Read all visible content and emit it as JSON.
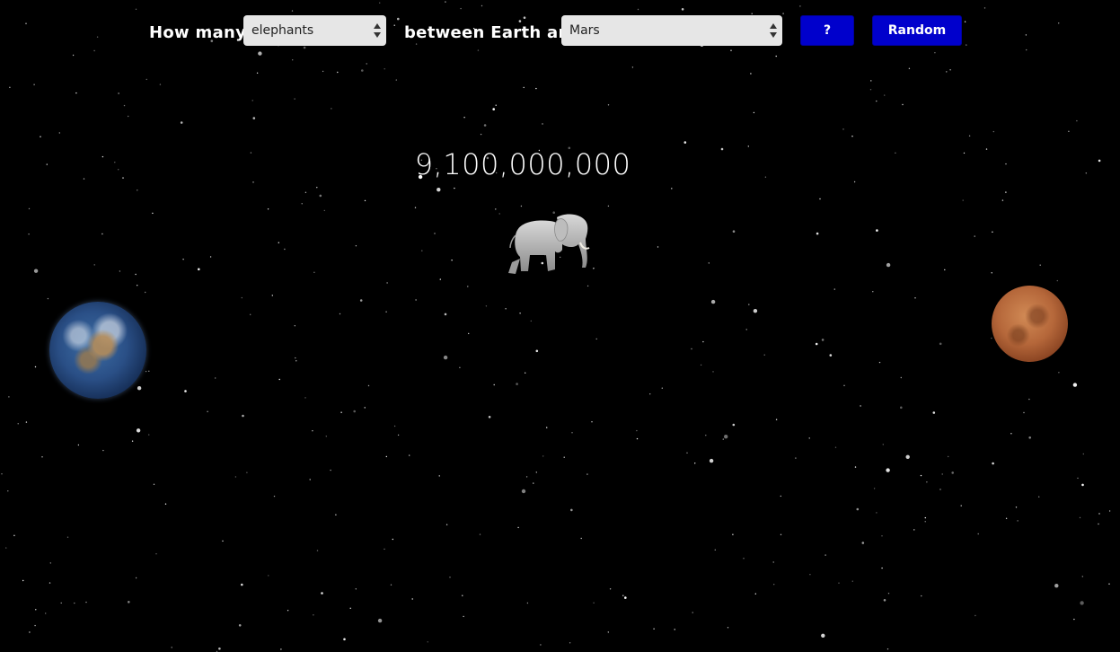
{
  "toolbar": {
    "how_many_label": "How many",
    "object_select": {
      "selected": "elephants"
    },
    "between_label": "between Earth and",
    "planet_select": {
      "selected": "Mars"
    },
    "help_button_label": "?",
    "random_button_label": "Random"
  },
  "result": {
    "count_text": "9,100,000,000"
  },
  "scene": {
    "left_planet_icon": "earth-icon",
    "right_planet_icon": "mars-icon",
    "object_icon": "elephant-icon"
  },
  "colors": {
    "background": "#000000",
    "button_blue": "#0000cc",
    "select_bg": "#e6e6e6",
    "text": "#ffffff"
  }
}
